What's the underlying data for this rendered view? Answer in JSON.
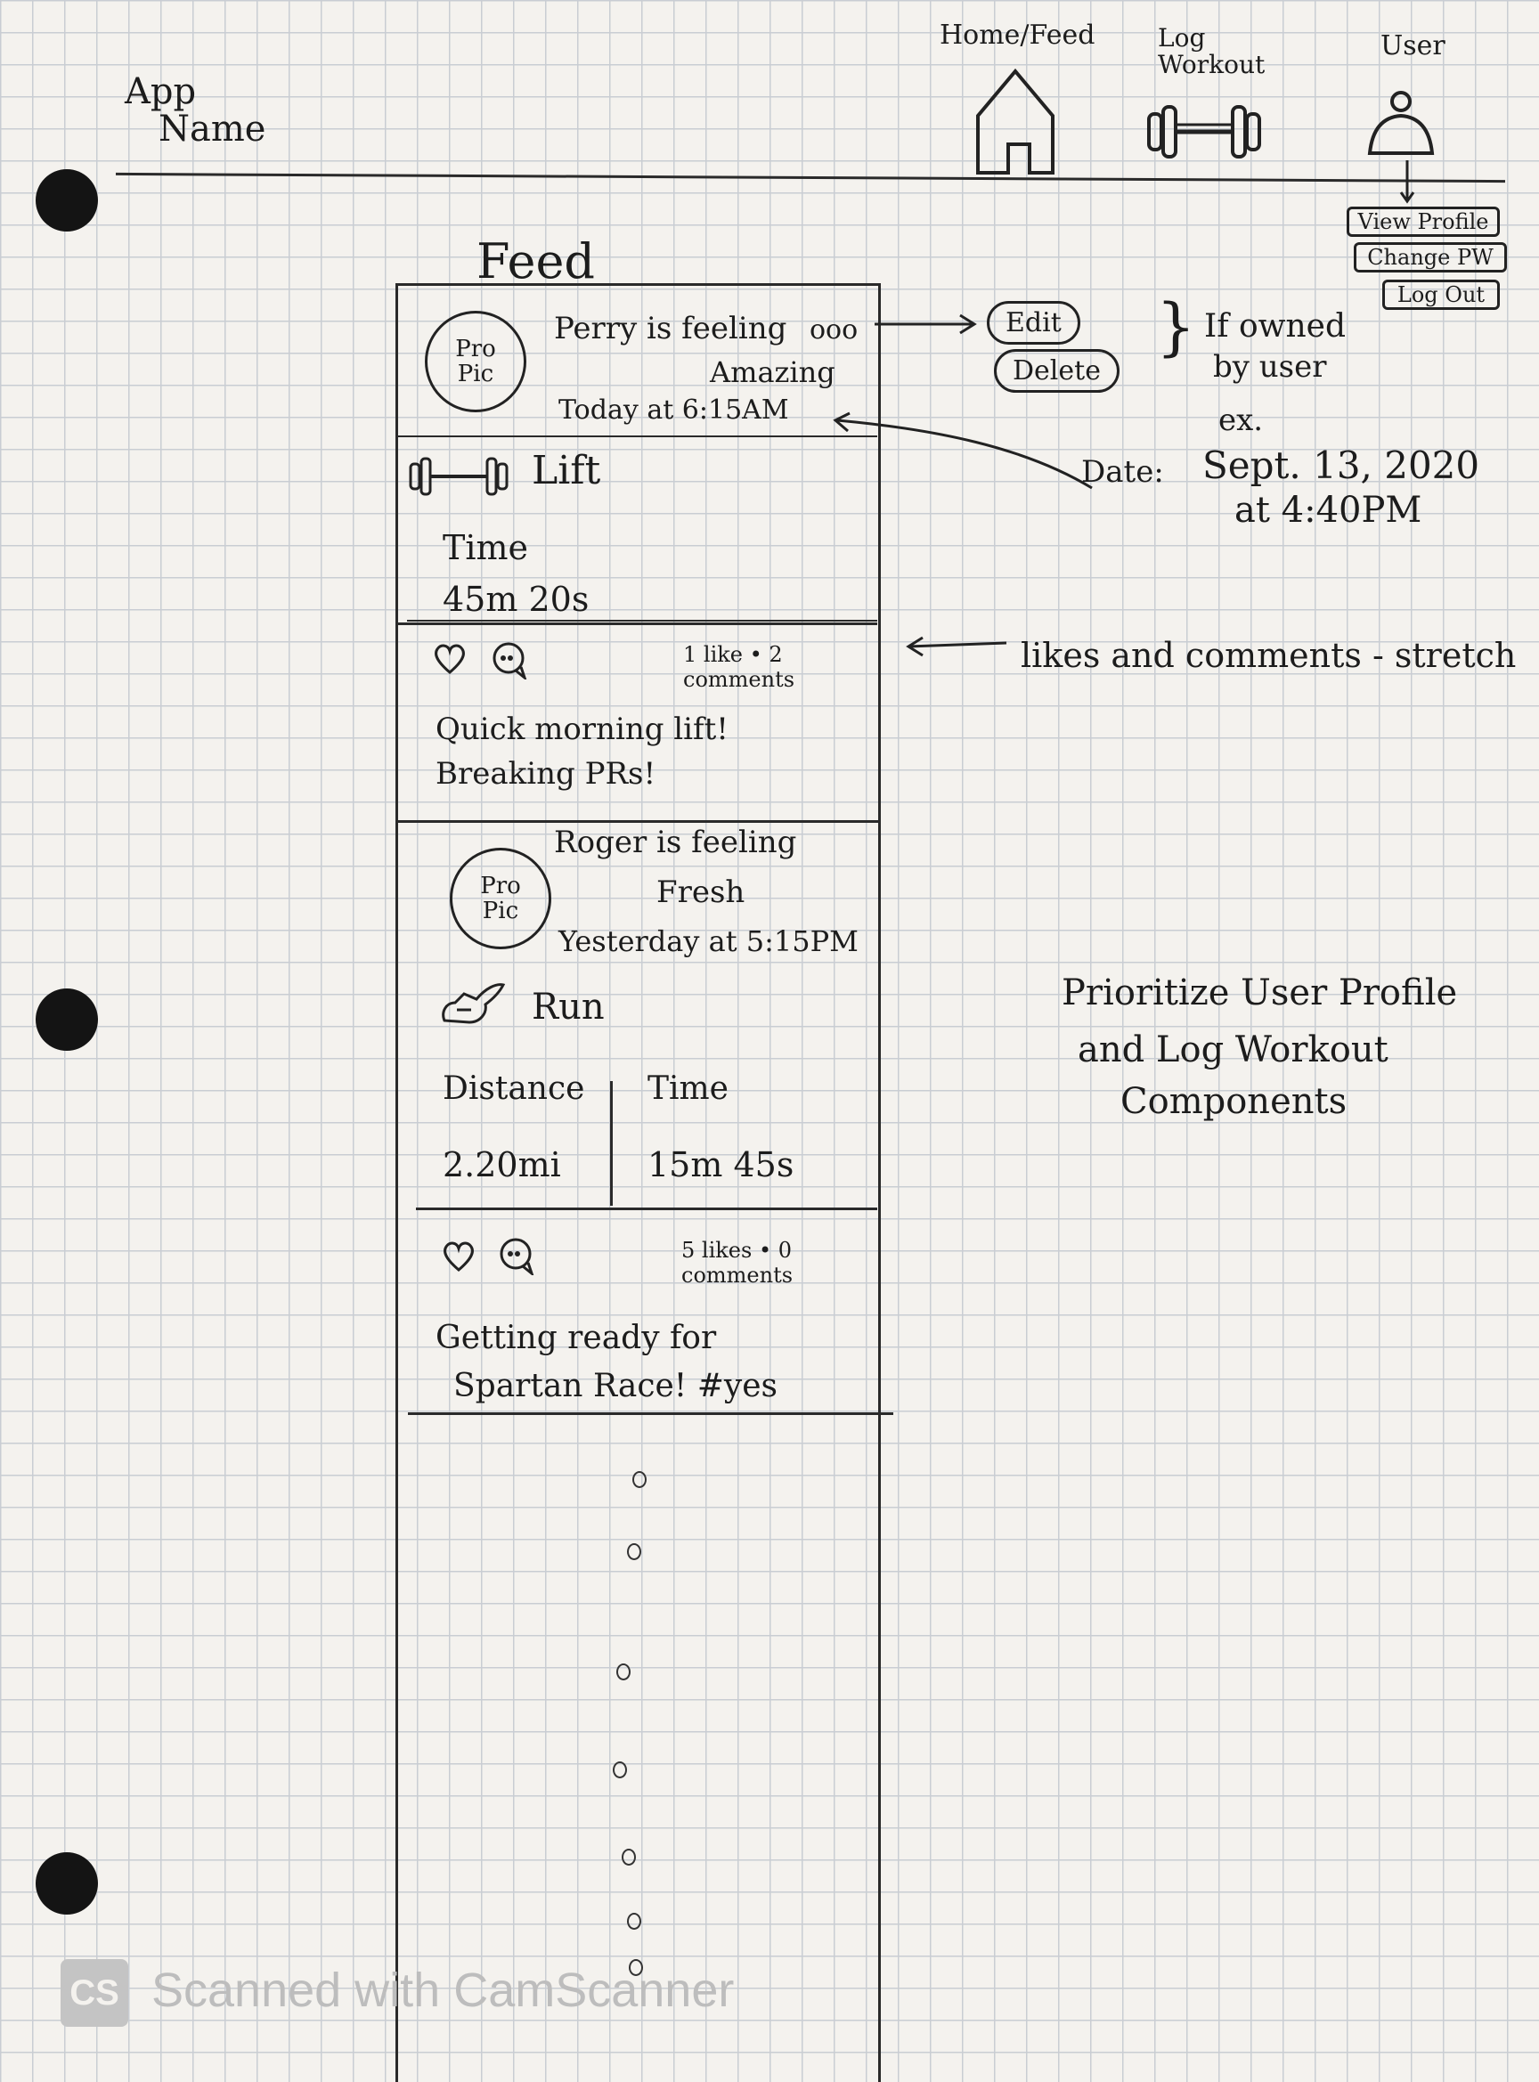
{
  "header": {
    "app_name_line1": "App",
    "app_name_line2": "Name",
    "nav": {
      "home_label": "Home/Feed",
      "log_label_line1": "Log",
      "log_label_line2": "Workout",
      "user_label": "User"
    },
    "user_menu": [
      "View Profile",
      "Change PW",
      "Log Out"
    ]
  },
  "feed": {
    "title": "Feed",
    "posts": [
      {
        "pic_label": "Pro\nPic",
        "line1": "Perry is feeling",
        "menu": "ooo",
        "line2": "Amazing",
        "time": "Today at 6:15AM",
        "workout": "Lift",
        "stat1_label": "Time",
        "stat1_value": "45m 20s",
        "counts": "1 like • 2 comments",
        "caption_line1": "Quick morning lift!",
        "caption_line2": "Breaking PRs!"
      },
      {
        "pic_label": "Pro\nPic",
        "line1": "Roger is feeling",
        "line2": "Fresh",
        "time": "Yesterday at 5:15PM",
        "workout": "Run",
        "stat1_label": "Distance",
        "stat1_value": "2.20mi",
        "stat2_label": "Time",
        "stat2_value": "15m 45s",
        "counts": "5 likes • 0 comments",
        "caption_line1": "Getting ready for",
        "caption_line2": "Spartan Race! #yes"
      }
    ]
  },
  "annotations": {
    "edit": "Edit",
    "delete": "Delete",
    "owned_line1": "If owned",
    "owned_line2": "by user",
    "ex": "ex.",
    "date_prefix": "Date:",
    "date_value": "Sept. 13, 2020",
    "date_time": "at 4:40PM",
    "likes_note": "likes and comments - stretch",
    "priority_line1": "Prioritize User Profile",
    "priority_line2": "and Log Workout",
    "priority_line3": "Components"
  },
  "watermark": {
    "logo": "CS",
    "text": "Scanned with CamScanner"
  }
}
